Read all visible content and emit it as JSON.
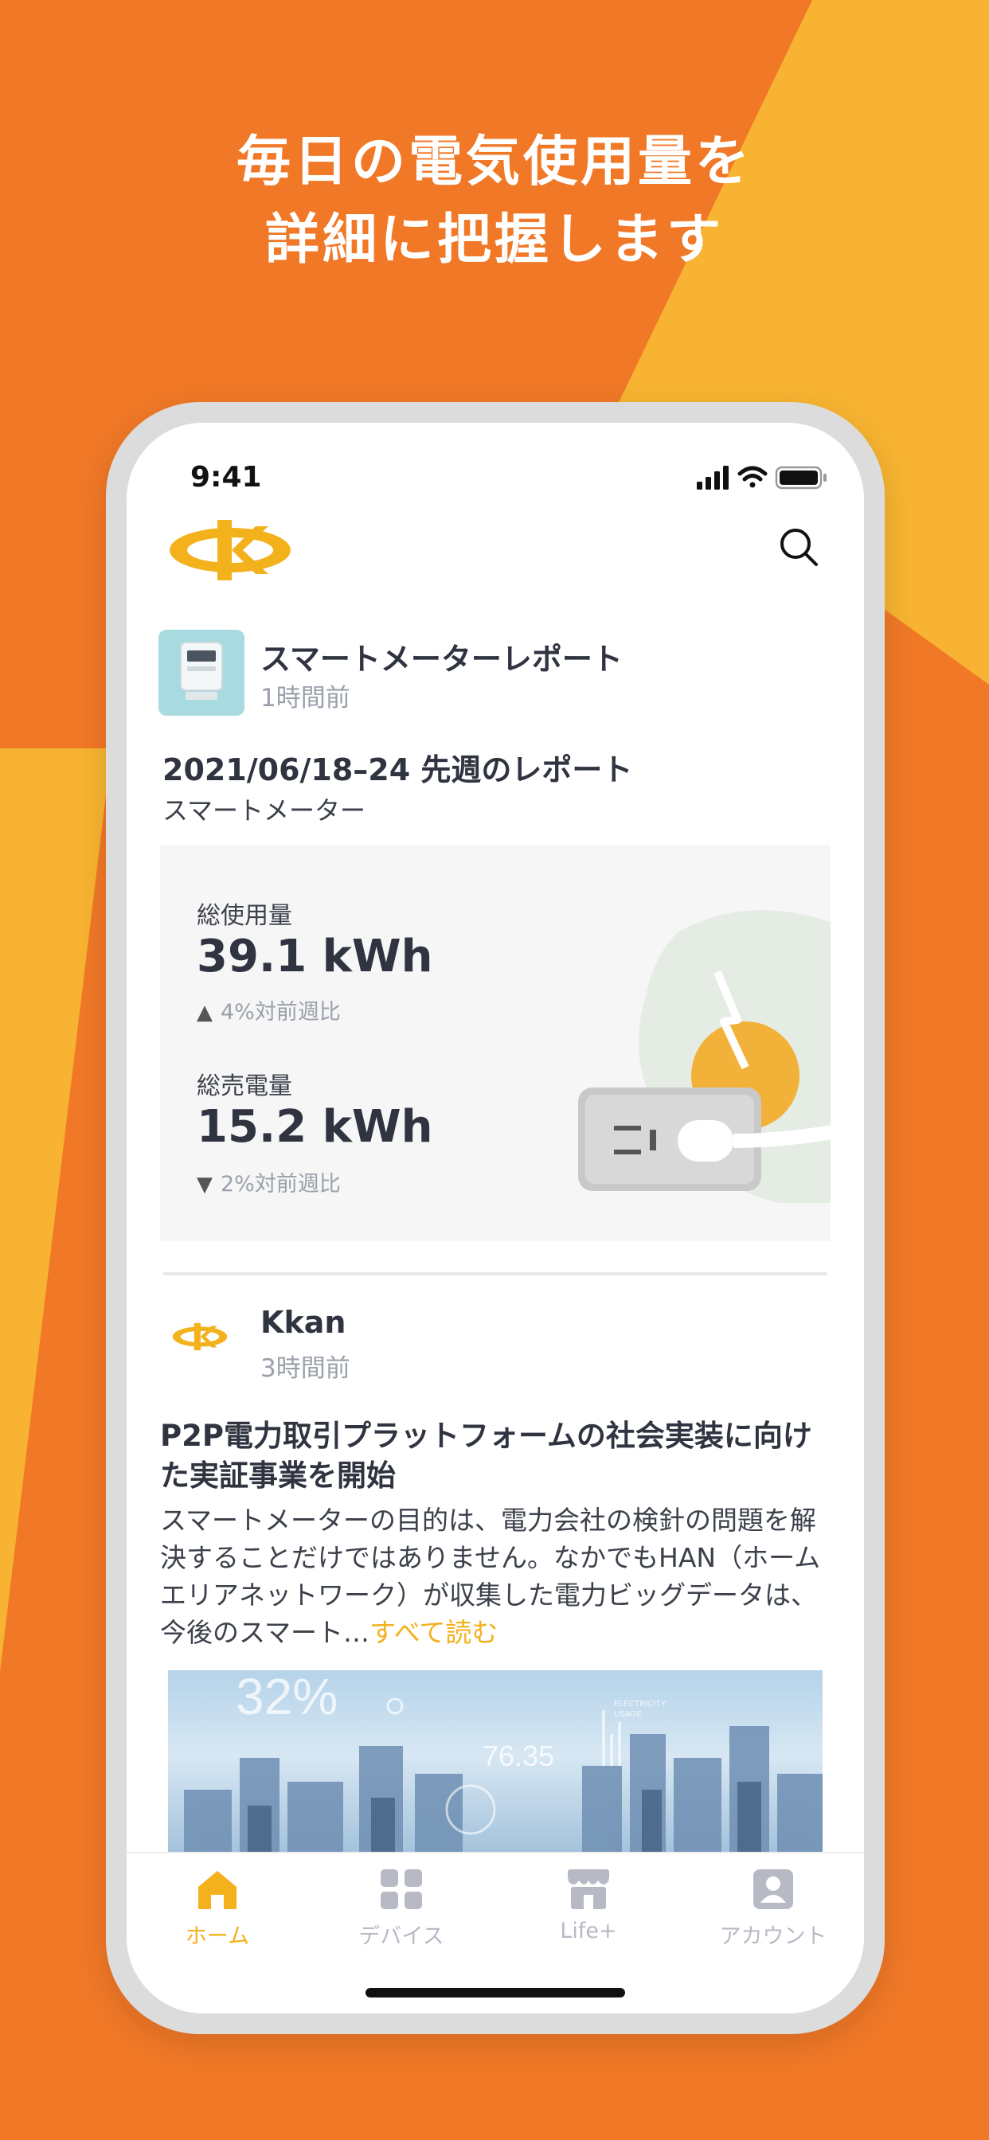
{
  "marketing": {
    "headline_line1": "毎日の電気使用量を",
    "headline_line2": "詳細に把握します",
    "colors": {
      "background": "#f07827",
      "accent": "#f7b331"
    }
  },
  "status_bar": {
    "time": "9:41"
  },
  "header": {
    "logo_icon": "kkan-logo",
    "search_icon": "search-icon"
  },
  "report_card": {
    "title": "スマートメーターレポート",
    "time_ago": "1時間前",
    "report_title": "2021/06/18–24 先週のレポート",
    "report_subtitle": "スマートメーター",
    "stats": [
      {
        "label": "総使用量",
        "value": "39.1 kWh",
        "direction": "up",
        "delta": "4%対前週比"
      },
      {
        "label": "総売電量",
        "value": "15.2 kWh",
        "direction": "down",
        "delta": "2%対前週比"
      }
    ]
  },
  "post": {
    "author": "Kkan",
    "time_ago": "3時間前",
    "title": "P2P電力取引プラットフォームの社会実装に向けた実証事業を開始",
    "body": "スマートメーターの目的は、電力会社の検針の問題を解決することだけではありません。なかでもHAN（ホームエリアネットワーク）が収集した電力ビッグデータは、今後のスマート…",
    "read_more": "すべて読む",
    "image_text": {
      "percent": "32%",
      "value": "76.35",
      "tag_line1": "ELECTRICITY",
      "tag_line2": "USAGE"
    }
  },
  "tabbar": {
    "tabs": [
      {
        "label": "ホーム",
        "icon": "home-icon",
        "active": true
      },
      {
        "label": "デバイス",
        "icon": "grid-icon",
        "active": false
      },
      {
        "label": "Life+",
        "icon": "store-icon",
        "active": false
      },
      {
        "label": "アカウント",
        "icon": "account-icon",
        "active": false
      }
    ],
    "active_color": "#f3b11c",
    "inactive_color": "#b7bac4"
  }
}
